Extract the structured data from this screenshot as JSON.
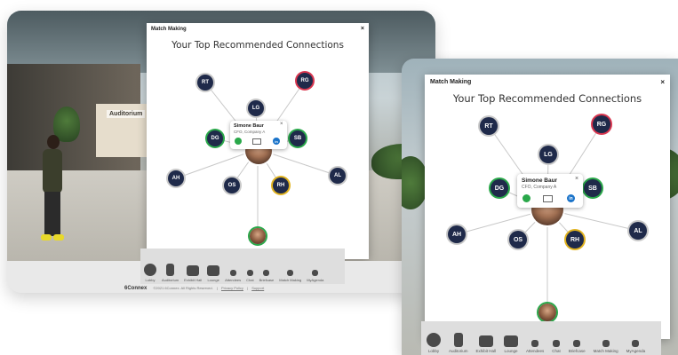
{
  "modal": {
    "title": "Match Making",
    "close": "×",
    "subtitle": "Your Top Recommended Connections"
  },
  "nodes": [
    {
      "id": "RT",
      "ring": "gray"
    },
    {
      "id": "RG",
      "ring": "pink"
    },
    {
      "id": "LG",
      "ring": "gray"
    },
    {
      "id": "DG",
      "ring": "green"
    },
    {
      "id": "SB",
      "ring": "green"
    },
    {
      "id": "AH",
      "ring": "gray"
    },
    {
      "id": "OS",
      "ring": "gray"
    },
    {
      "id": "RH",
      "ring": "yellow"
    },
    {
      "id": "AL",
      "ring": "gray"
    }
  ],
  "profile_card": {
    "name": "Simone Baur",
    "role": "CFO, Company A",
    "close": "×",
    "linkedin": "in",
    "chat_icon": "chat-bubble-icon",
    "mail_icon": "envelope-icon",
    "linkedin_icon": "linkedin-icon"
  },
  "taskbar": {
    "items": [
      {
        "label": "Lobby",
        "icon": "lobby-icon"
      },
      {
        "label": "Auditorium",
        "icon": "auditorium-icon"
      },
      {
        "label": "Exhibit Hall",
        "icon": "exhibit-hall-icon"
      },
      {
        "label": "Lounge",
        "icon": "lounge-icon"
      },
      {
        "label": "Attendees",
        "icon": "attendees-icon"
      },
      {
        "label": "Chat",
        "icon": "chat-icon"
      },
      {
        "label": "Briefcase",
        "icon": "briefcase-icon"
      },
      {
        "label": "Match Making",
        "icon": "match-making-icon"
      },
      {
        "label": "MyAgenda",
        "icon": "agenda-icon"
      }
    ]
  },
  "back_scene": {
    "sign_text": "Auditorium"
  },
  "footer": {
    "logo": "6Connex",
    "copyright": "©2021 6Connex. All Rights Reserved.",
    "privacy": "Privacy Policy",
    "support": "Support"
  },
  "colors": {
    "node_fill": "#1f2a4a",
    "ring_pink": "#d9364f",
    "ring_green": "#2aa84a",
    "ring_yellow": "#e0b21f",
    "linkedin": "#1a73c9"
  }
}
